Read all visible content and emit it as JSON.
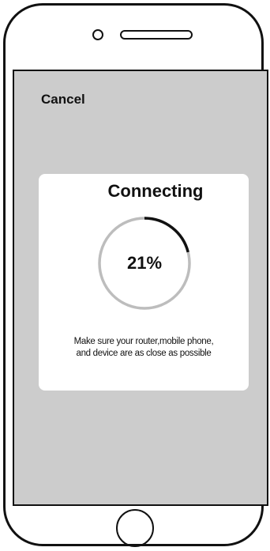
{
  "device": {
    "camera_icon": "circle",
    "speaker_icon": "rounded-slot",
    "home_button_icon": "circle"
  },
  "screen": {
    "background": "#cccccc",
    "cancel_label": "Cancel"
  },
  "dialog": {
    "title": "Connecting",
    "progress": {
      "value": 21,
      "label": "21%",
      "track_color": "#bdbdbd",
      "fill_color": "#111111"
    },
    "hint_line_1": "Make sure your router,mobile phone,",
    "hint_line_2": "and device are as close as possible"
  }
}
